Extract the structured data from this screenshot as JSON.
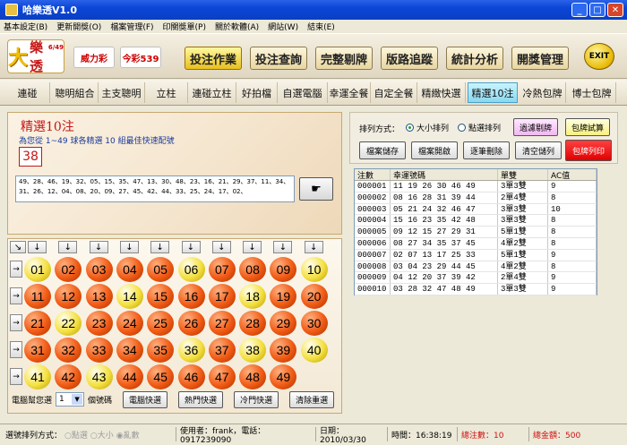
{
  "window": {
    "title": "哈樂透V1.0"
  },
  "menu": [
    "基本設定(B)",
    "更新開獎(O)",
    "檔案管理(F)",
    "印關獎單(P)",
    "關於軟體(A)",
    "網站(W)",
    "結束(E)"
  ],
  "logos": {
    "main": "樂透",
    "main_num": "6/49",
    "secondary": "威力彩",
    "third": "今彩539"
  },
  "topnav": [
    "投注作業",
    "投注查詢",
    "完整剔牌",
    "版路追蹤",
    "統計分析",
    "開獎管理"
  ],
  "exit_label": "EXIT",
  "tabs": [
    "連碰",
    "聰明組合",
    "主支聰明",
    "立柱",
    "連碰立柱",
    "好拍檔",
    "自選電腦",
    "幸運全餐",
    "自定全餐",
    "精緻快選",
    "精選10注",
    "冷熱包牌",
    "博士包牌"
  ],
  "active_tab": "精選10注",
  "pick": {
    "title": "精選10注",
    "desc": "為您從 1~49 球各精選 10 組最佳快速配號",
    "count": "38",
    "numbers_text": "49、28、46、19、32、05、15、35、47、13、30、48、23、16、21、29、37、11、34、31、26、12、04、08、20、09、27、45、42、44、33、25、24、17、02、"
  },
  "grid": {
    "arrow_down": "↓",
    "arrow_right": "→",
    "corner_arrow": "↘",
    "balls": [
      {
        "n": "01",
        "c": "yellow"
      },
      {
        "n": "02",
        "c": "orange"
      },
      {
        "n": "03",
        "c": "orange"
      },
      {
        "n": "04",
        "c": "orange"
      },
      {
        "n": "05",
        "c": "orange"
      },
      {
        "n": "06",
        "c": "yellow"
      },
      {
        "n": "07",
        "c": "orange"
      },
      {
        "n": "08",
        "c": "orange"
      },
      {
        "n": "09",
        "c": "orange"
      },
      {
        "n": "10",
        "c": "yellow"
      },
      {
        "n": "11",
        "c": "orange"
      },
      {
        "n": "12",
        "c": "orange"
      },
      {
        "n": "13",
        "c": "orange"
      },
      {
        "n": "14",
        "c": "yellow"
      },
      {
        "n": "15",
        "c": "orange"
      },
      {
        "n": "16",
        "c": "orange"
      },
      {
        "n": "17",
        "c": "orange"
      },
      {
        "n": "18",
        "c": "yellow"
      },
      {
        "n": "19",
        "c": "orange"
      },
      {
        "n": "20",
        "c": "orange"
      },
      {
        "n": "21",
        "c": "orange"
      },
      {
        "n": "22",
        "c": "yellow"
      },
      {
        "n": "23",
        "c": "orange"
      },
      {
        "n": "24",
        "c": "orange"
      },
      {
        "n": "25",
        "c": "orange"
      },
      {
        "n": "26",
        "c": "orange"
      },
      {
        "n": "27",
        "c": "orange"
      },
      {
        "n": "28",
        "c": "orange"
      },
      {
        "n": "29",
        "c": "orange"
      },
      {
        "n": "30",
        "c": "orange"
      },
      {
        "n": "31",
        "c": "orange"
      },
      {
        "n": "32",
        "c": "orange"
      },
      {
        "n": "33",
        "c": "orange"
      },
      {
        "n": "34",
        "c": "orange"
      },
      {
        "n": "35",
        "c": "orange"
      },
      {
        "n": "36",
        "c": "yellow"
      },
      {
        "n": "37",
        "c": "orange"
      },
      {
        "n": "38",
        "c": "yellow"
      },
      {
        "n": "39",
        "c": "orange"
      },
      {
        "n": "40",
        "c": "yellow"
      },
      {
        "n": "41",
        "c": "yellow"
      },
      {
        "n": "42",
        "c": "orange"
      },
      {
        "n": "43",
        "c": "yellow"
      },
      {
        "n": "44",
        "c": "orange"
      },
      {
        "n": "45",
        "c": "orange"
      },
      {
        "n": "46",
        "c": "orange"
      },
      {
        "n": "47",
        "c": "orange"
      },
      {
        "n": "48",
        "c": "orange"
      },
      {
        "n": "49",
        "c": "orange"
      }
    ],
    "pick_label": "電腦幫您選",
    "pick_value": "1",
    "pick_unit": "個號碼",
    "buttons": [
      "電腦快選",
      "熱門快選",
      "冷門快選",
      "清除重選"
    ]
  },
  "right": {
    "sort_label": "排列方式：",
    "sort_options": [
      "大小排列",
      "點選排列"
    ],
    "sort_selected": "大小排列",
    "buttons_top": [
      "過濾剔牌",
      "包牌試算"
    ],
    "buttons_bottom": [
      "檔案儲存",
      "檔案開啟",
      "逐筆刪除",
      "清空儲列",
      "包牌列印"
    ]
  },
  "table": {
    "headers": [
      "注數",
      "幸運號碼",
      "單雙",
      "AC值"
    ],
    "rows": [
      [
        "000001",
        "11 19 26 30 46 49",
        "3單3雙",
        "9"
      ],
      [
        "000002",
        "08 16 28 31 39 44",
        "2單4雙",
        "8"
      ],
      [
        "000003",
        "05 21 24 32 46 47",
        "3單3雙",
        "10"
      ],
      [
        "000004",
        "15 16 23 35 42 48",
        "3單3雙",
        "8"
      ],
      [
        "000005",
        "09 12 15 27 29 31",
        "5單1雙",
        "8"
      ],
      [
        "000006",
        "08 27 34 35 37 45",
        "4單2雙",
        "8"
      ],
      [
        "000007",
        "02 07 13 17 25 33",
        "5單1雙",
        "9"
      ],
      [
        "000008",
        "03 04 23 29 44 45",
        "4單2雙",
        "8"
      ],
      [
        "000009",
        "04 12 20 37 39 42",
        "2單4雙",
        "9"
      ],
      [
        "000010",
        "03 28 32 47 48 49",
        "3單3雙",
        "9"
      ]
    ]
  },
  "status": {
    "sort_label": "選號排列方式：",
    "sort_options": [
      "點選",
      "大小",
      "亂數"
    ],
    "user_label": "使用者：frank，電話：0917239090",
    "date_label": "日期：2010/03/30",
    "time_label": "時間：16:38:19",
    "total_bets_label": "總注數：10",
    "total_amount_label": "總金額：500"
  }
}
